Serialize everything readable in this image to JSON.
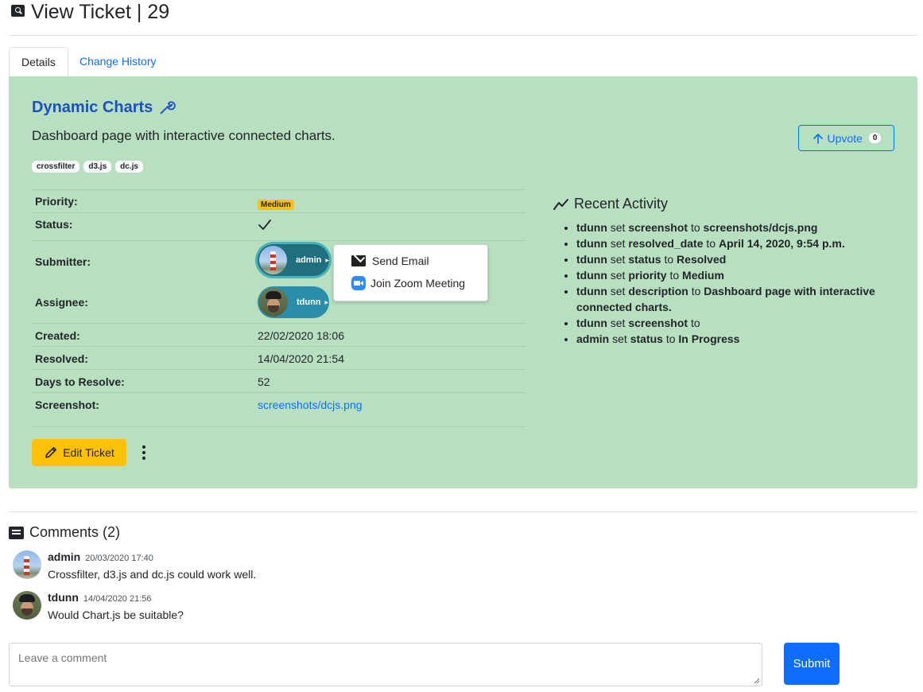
{
  "header": {
    "title": "View Ticket | 29"
  },
  "tabs": [
    {
      "label": "Details",
      "active": true
    },
    {
      "label": "Change History",
      "active": false
    }
  ],
  "ticket": {
    "title": "Dynamic Charts",
    "description": "Dashboard page with interactive connected charts.",
    "tags": [
      "crossfilter",
      "d3.js",
      "dc.js"
    ],
    "upvote": {
      "label": "Upvote",
      "count": "0"
    }
  },
  "details": {
    "priority": {
      "label": "Priority:",
      "value": "Medium"
    },
    "status": {
      "label": "Status:",
      "value": "✓"
    },
    "submitter": {
      "label": "Submitter:",
      "value": "admin"
    },
    "assignee": {
      "label": "Assignee:",
      "value": "tdunn"
    },
    "created": {
      "label": "Created:",
      "value": "22/02/2020 18:06"
    },
    "resolved": {
      "label": "Resolved:",
      "value": "14/04/2020 21:54"
    },
    "days": {
      "label": "Days to Resolve:",
      "value": "52"
    },
    "screenshot": {
      "label": "Screenshot:",
      "value": "screenshots/dcjs.png"
    }
  },
  "popup": {
    "email": "Send Email",
    "zoom": "Join Zoom Meeting"
  },
  "actions": {
    "edit": "Edit Ticket"
  },
  "activity": {
    "title": "Recent Activity",
    "items": [
      {
        "user": "tdunn",
        "verb": "set",
        "field": "screenshot",
        "to": "to",
        "value": "screenshots/dcjs.png"
      },
      {
        "user": "tdunn",
        "verb": "set",
        "field": "resolved_date",
        "to": "to",
        "value": "April 14, 2020, 9:54 p.m."
      },
      {
        "user": "tdunn",
        "verb": "set",
        "field": "status",
        "to": "to",
        "value": "Resolved"
      },
      {
        "user": "tdunn",
        "verb": "set",
        "field": "priority",
        "to": "to",
        "value": "Medium"
      },
      {
        "user": "tdunn",
        "verb": "set",
        "field": "description",
        "to": "to",
        "value": "Dashboard page with interactive connected charts."
      },
      {
        "user": "tdunn",
        "verb": "set",
        "field": "screenshot",
        "to": "to",
        "value": ""
      },
      {
        "user": "admin",
        "verb": "set",
        "field": "status",
        "to": "to",
        "value": "In Progress"
      }
    ]
  },
  "comments": {
    "title": "Comments (2)",
    "items": [
      {
        "user": "admin",
        "date": "20/03/2020 17:40",
        "text": "Crossfilter, d3.js and dc.js could work well."
      },
      {
        "user": "tdunn",
        "date": "14/04/2020 21:56",
        "text": "Would Chart.js be suitable?"
      }
    ],
    "placeholder": "Leave a comment",
    "submit": "Submit"
  },
  "colors": {
    "card_bg": "#b8e0c0",
    "primary": "#0d6efd",
    "warning": "#ffc107"
  }
}
